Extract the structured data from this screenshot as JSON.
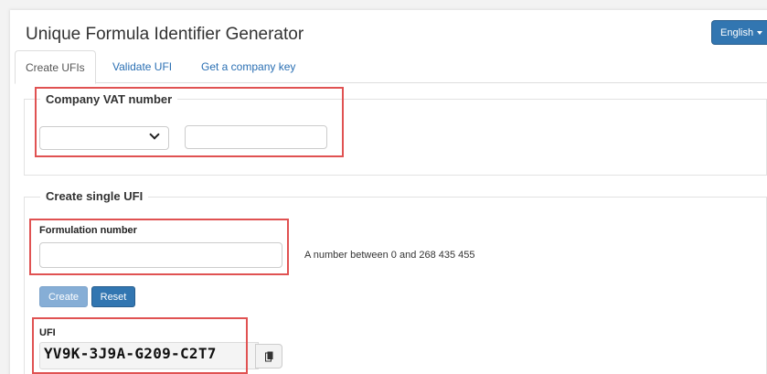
{
  "app": {
    "title": "Unique Formula Identifier Generator"
  },
  "language": {
    "label": "English"
  },
  "tabs": [
    {
      "label": "Create UFIs",
      "active": true
    },
    {
      "label": "Validate UFI",
      "active": false
    },
    {
      "label": "Get a company key",
      "active": false
    }
  ],
  "company": {
    "legend": "Company VAT number",
    "country_value": "",
    "vat_value": ""
  },
  "single": {
    "legend": "Create single UFI",
    "formulation_label": "Formulation number",
    "formulation_value": "",
    "help": "A number between 0 and 268 435 455",
    "create_label": "Create",
    "reset_label": "Reset",
    "ufi_label": "UFI",
    "ufi_value": "YV9K-3J9A-G209-C2T7"
  },
  "colors": {
    "primary": "#3276b1",
    "primary_disabled": "#86aed6",
    "link": "#2a6fb3",
    "highlight": "#e05252"
  },
  "icons": {
    "dropdown": "chevron-down-icon",
    "language_caret": "caret-down-icon",
    "copy": "clipboard-icon"
  }
}
